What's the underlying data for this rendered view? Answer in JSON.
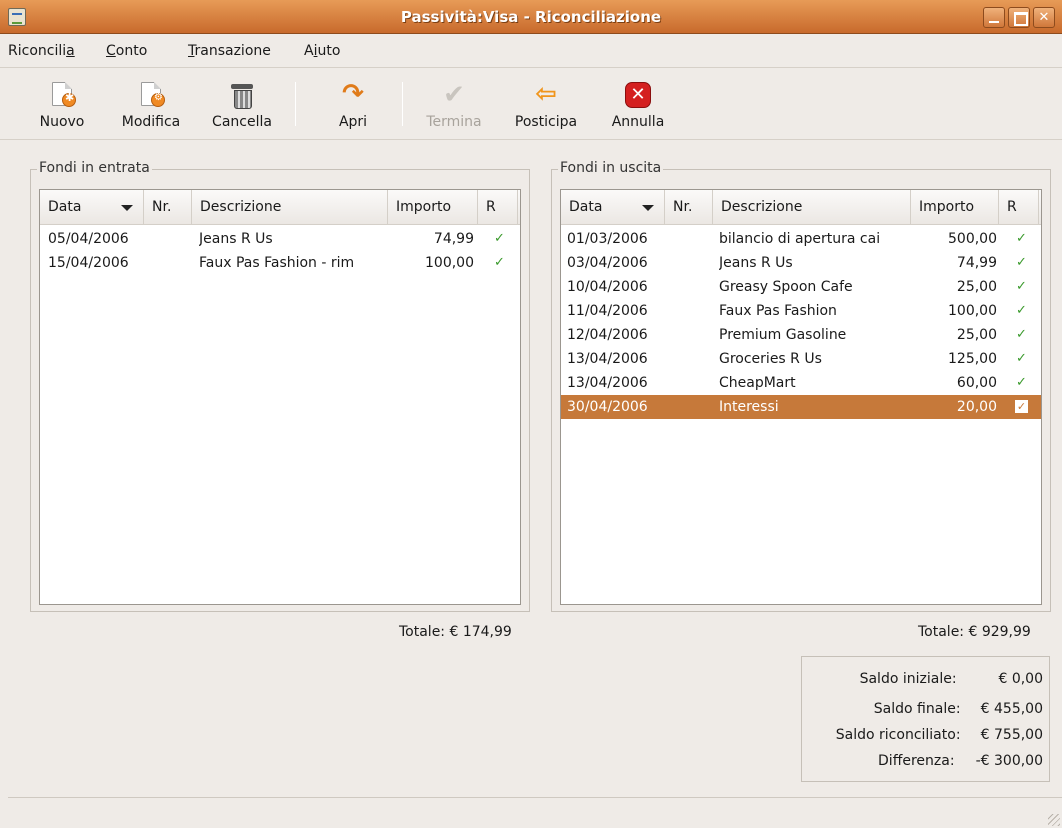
{
  "window": {
    "title": "Passività:Visa - Riconciliazione"
  },
  "menubar": {
    "items": [
      {
        "pre": "Riconcili",
        "u": "a",
        "post": ""
      },
      {
        "pre": "",
        "u": "C",
        "post": "onto"
      },
      {
        "pre": "",
        "u": "T",
        "post": "ransazione"
      },
      {
        "pre": "A",
        "u": "i",
        "post": "uto"
      }
    ]
  },
  "toolbar": {
    "nuovo": "Nuovo",
    "modifica": "Modifica",
    "cancella": "Cancella",
    "apri": "Apri",
    "termina": "Termina",
    "posticipa": "Posticipa",
    "annulla": "Annulla"
  },
  "icons": {
    "nuovo": "new-document-icon",
    "modifica": "edit-document-icon",
    "cancella": "trash-icon",
    "apri": "open-arrow-icon",
    "termina": "check-icon",
    "posticipa": "postpone-arrow-icon",
    "annulla": "cancel-icon"
  },
  "columns": {
    "data": "Data",
    "nr": "Nr.",
    "descrizione": "Descrizione",
    "importo": "Importo",
    "r": "R"
  },
  "incoming": {
    "label": "Fondi in entrata",
    "total": "Totale: € 174,99",
    "rows": [
      {
        "date": "05/04/2006",
        "nr": "",
        "desc": "Jeans R Us",
        "amount": "74,99",
        "r": "✓"
      },
      {
        "date": "15/04/2006",
        "nr": "",
        "desc": "Faux Pas Fashion - rim",
        "amount": "100,00",
        "r": "✓"
      }
    ]
  },
  "outgoing": {
    "label": "Fondi in uscita",
    "total": "Totale: € 929,99",
    "rows": [
      {
        "date": "01/03/2006",
        "nr": "",
        "desc": "bilancio di apertura cai",
        "amount": "500,00",
        "r": "✓"
      },
      {
        "date": "03/04/2006",
        "nr": "",
        "desc": "Jeans R Us",
        "amount": "74,99",
        "r": "✓"
      },
      {
        "date": "10/04/2006",
        "nr": "",
        "desc": "Greasy Spoon Cafe",
        "amount": "25,00",
        "r": "✓"
      },
      {
        "date": "11/04/2006",
        "nr": "",
        "desc": "Faux Pas Fashion",
        "amount": "100,00",
        "r": "✓"
      },
      {
        "date": "12/04/2006",
        "nr": "",
        "desc": "Premium Gasoline",
        "amount": "25,00",
        "r": "✓"
      },
      {
        "date": "13/04/2006",
        "nr": "",
        "desc": "Groceries R Us",
        "amount": "125,00",
        "r": "✓"
      },
      {
        "date": "13/04/2006",
        "nr": "",
        "desc": "CheapMart",
        "amount": "60,00",
        "r": "✓"
      },
      {
        "date": "30/04/2006",
        "nr": "",
        "desc": "Interessi",
        "amount": "20,00",
        "r": "✓",
        "selected": true
      }
    ]
  },
  "summary": {
    "saldo_iniziale_label": "Saldo iniziale:",
    "saldo_iniziale": "€ 0,00",
    "saldo_finale_label": "Saldo finale:",
    "saldo_finale": "€ 455,00",
    "saldo_riconciliato_label": "Saldo riconciliato:",
    "saldo_riconciliato": "€ 755,00",
    "differenza_label": "Differenza:",
    "differenza": "-€ 300,00"
  },
  "colors": {
    "selection": "#c6793a",
    "titlebar": "#d97c3a",
    "check": "#3a9a2c"
  }
}
